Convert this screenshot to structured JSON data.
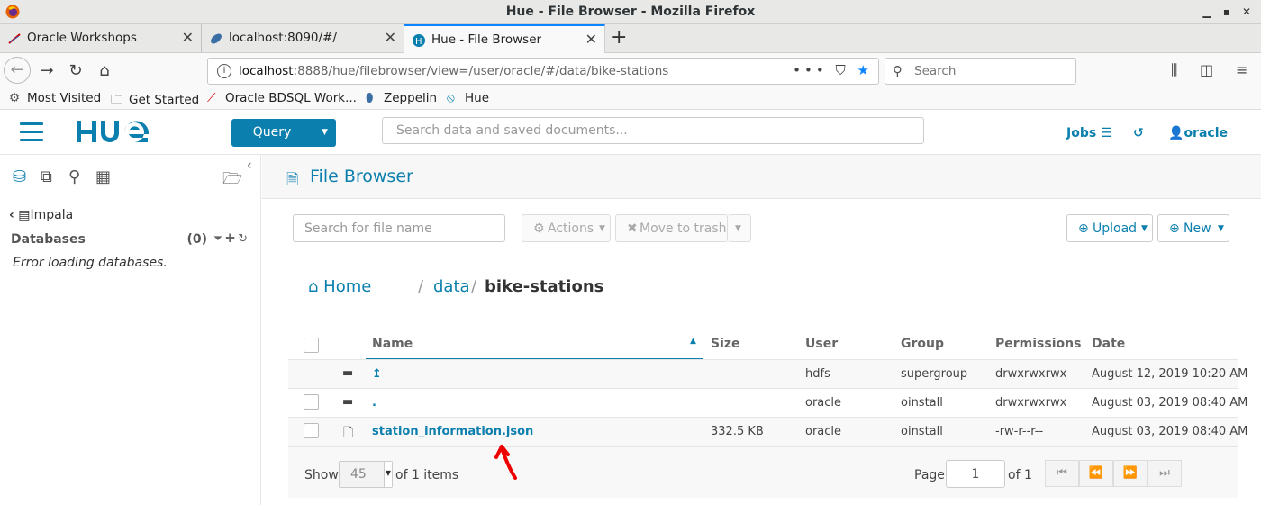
{
  "window": {
    "title": "Hue - File Browser - Mozilla Firefox"
  },
  "tabs": [
    {
      "label": "Oracle Workshops",
      "icon": "oracle-icon"
    },
    {
      "label": "localhost:8090/#/",
      "icon": "zeppelin-icon"
    },
    {
      "label": "Hue - File Browser",
      "icon": "hue-icon",
      "active": true
    }
  ],
  "navbar": {
    "url_host": "localhost",
    "url_rest": ":8888/hue/filebrowser/view=/user/oracle/#/data/bike-stations",
    "search_placeholder": "Search"
  },
  "bookmarks": [
    {
      "label": "Most Visited",
      "icon": "gear-icon"
    },
    {
      "label": "Get Started",
      "icon": "folder-icon"
    },
    {
      "label": "Oracle BDSQL Work...",
      "icon": "oracle-icon"
    },
    {
      "label": "Zeppelin",
      "icon": "zeppelin-icon"
    },
    {
      "label": "Hue",
      "icon": "hue-icon"
    }
  ],
  "hue": {
    "query_label": "Query",
    "search_placeholder": "Search data and saved documents...",
    "jobs_label": "Jobs",
    "user_label": "oracle",
    "brand_color": "#0B7FAD"
  },
  "sidebar": {
    "engine": "Impala",
    "databases_label": "Databases",
    "databases_count": "(0)",
    "error": "Error loading databases."
  },
  "main": {
    "title": "File Browser",
    "file_search_placeholder": "Search for file name",
    "actions_label": "Actions",
    "trash_label": "Move to trash",
    "upload_label": "Upload",
    "new_label": "New",
    "breadcrumb": {
      "home": "Home",
      "sep": "/",
      "parent": "data",
      "current": "bike-stations"
    },
    "columns": {
      "name": "Name",
      "size": "Size",
      "user": "User",
      "group": "Group",
      "permissions": "Permissions",
      "date": "Date"
    },
    "rows": [
      {
        "name": "↥",
        "type": "folder",
        "size": "",
        "user": "hdfs",
        "group": "supergroup",
        "permissions": "drwxrwxrwx",
        "date": "August 12, 2019 10:20 AM"
      },
      {
        "name": ".",
        "type": "folder",
        "size": "",
        "user": "oracle",
        "group": "oinstall",
        "permissions": "drwxrwxrwx",
        "date": "August 03, 2019 08:40 AM"
      },
      {
        "name": "station_information.json",
        "type": "file",
        "size": "332.5 KB",
        "user": "oracle",
        "group": "oinstall",
        "permissions": "-rw-r--r--",
        "date": "August 03, 2019 08:40 AM"
      }
    ],
    "footer": {
      "show_label": "Show",
      "page_size": "45",
      "items_label": "of 1 items",
      "page_label": "Page",
      "page_value": "1",
      "page_of": "of 1"
    }
  }
}
